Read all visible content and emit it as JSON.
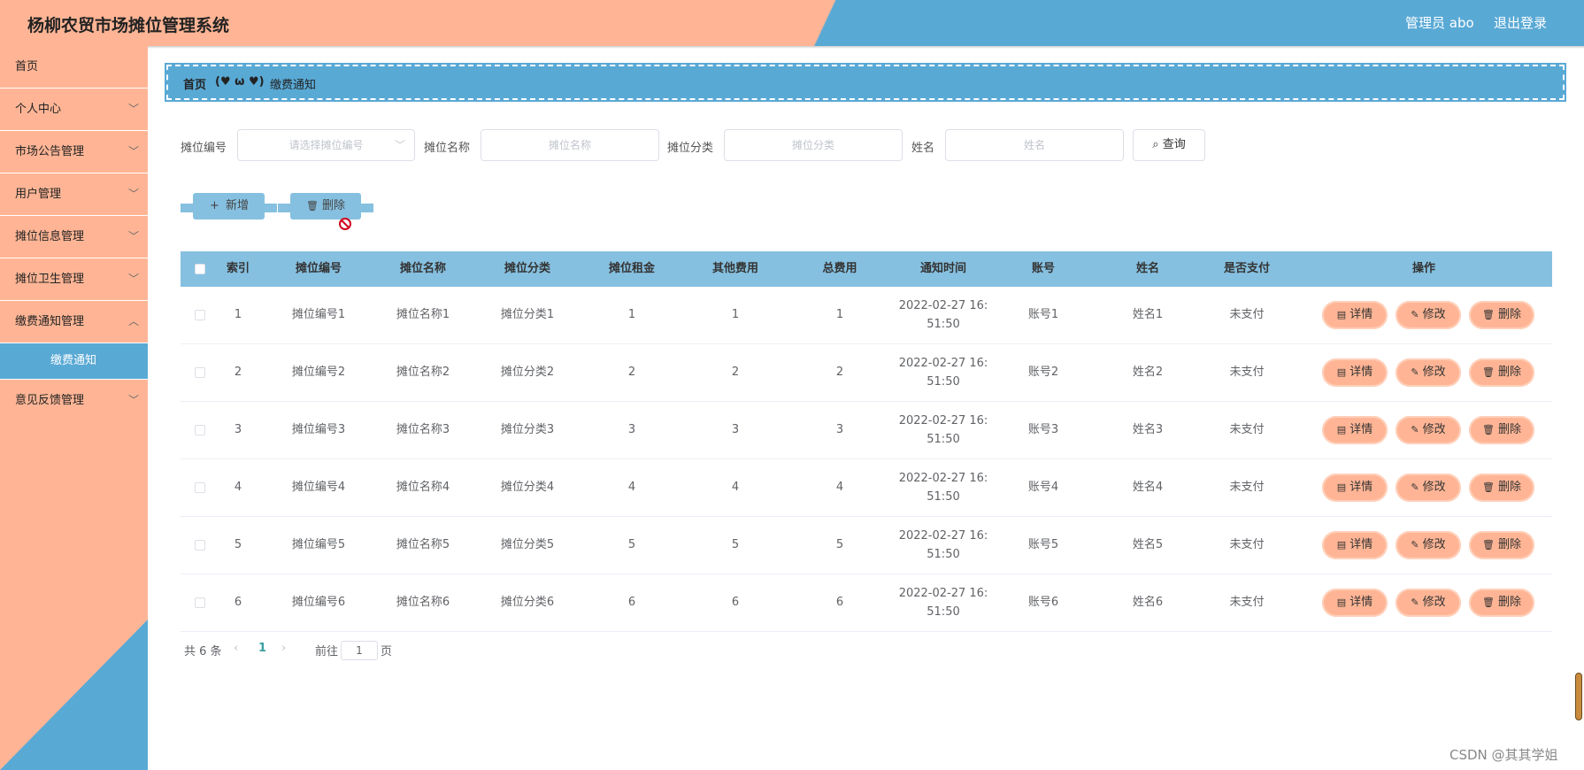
{
  "header": {
    "title": "杨柳农贸市场摊位管理系统",
    "admin": "管理员 abo",
    "logout": "退出登录"
  },
  "sidebar": {
    "items": [
      {
        "label": "首页",
        "has_chevron": false
      },
      {
        "label": "个人中心",
        "has_chevron": true
      },
      {
        "label": "市场公告管理",
        "has_chevron": true
      },
      {
        "label": "用户管理",
        "has_chevron": true
      },
      {
        "label": "摊位信息管理",
        "has_chevron": true
      },
      {
        "label": "摊位卫生管理",
        "has_chevron": true
      },
      {
        "label": "缴费通知管理",
        "has_chevron": true
      }
    ],
    "active_sub": "缴费通知",
    "last_item": "意见反馈管理"
  },
  "breadcrumb": {
    "home": "首页",
    "separator": "(♥ ω ♥)",
    "current": "缴费通知"
  },
  "search": {
    "stall_no_label": "摊位编号",
    "stall_no_placeholder": "请选择摊位编号",
    "stall_name_label": "摊位名称",
    "stall_name_placeholder": "摊位名称",
    "stall_cat_label": "摊位分类",
    "stall_cat_placeholder": "摊位分类",
    "name_label": "姓名",
    "name_placeholder": "姓名",
    "query_button": "查询"
  },
  "actions": {
    "add": "新增",
    "delete": "删除"
  },
  "table": {
    "headers": [
      "索引",
      "摊位编号",
      "摊位名称",
      "摊位分类",
      "摊位租金",
      "其他费用",
      "总费用",
      "通知时间",
      "账号",
      "姓名",
      "是否支付",
      "操作"
    ],
    "rows": [
      {
        "idx": "1",
        "no": "摊位编号1",
        "name": "摊位名称1",
        "cat": "摊位分类1",
        "rent": "1",
        "other": "1",
        "total": "1",
        "time": "2022-02-27 16:51:50",
        "time_a": "2022-02-27 16:",
        "time_b": "51:50",
        "account": "账号1",
        "person": "姓名1",
        "paid": "未支付"
      },
      {
        "idx": "2",
        "no": "摊位编号2",
        "name": "摊位名称2",
        "cat": "摊位分类2",
        "rent": "2",
        "other": "2",
        "total": "2",
        "time": "2022-02-27 16:51:50",
        "time_a": "2022-02-27 16:",
        "time_b": "51:50",
        "account": "账号2",
        "person": "姓名2",
        "paid": "未支付"
      },
      {
        "idx": "3",
        "no": "摊位编号3",
        "name": "摊位名称3",
        "cat": "摊位分类3",
        "rent": "3",
        "other": "3",
        "total": "3",
        "time": "2022-02-27 16:51:50",
        "time_a": "2022-02-27 16:",
        "time_b": "51:50",
        "account": "账号3",
        "person": "姓名3",
        "paid": "未支付"
      },
      {
        "idx": "4",
        "no": "摊位编号4",
        "name": "摊位名称4",
        "cat": "摊位分类4",
        "rent": "4",
        "other": "4",
        "total": "4",
        "time": "2022-02-27 16:51:50",
        "time_a": "2022-02-27 16:",
        "time_b": "51:50",
        "account": "账号4",
        "person": "姓名4",
        "paid": "未支付"
      },
      {
        "idx": "5",
        "no": "摊位编号5",
        "name": "摊位名称5",
        "cat": "摊位分类5",
        "rent": "5",
        "other": "5",
        "total": "5",
        "time": "2022-02-27 16:51:50",
        "time_a": "2022-02-27 16:",
        "time_b": "51:50",
        "account": "账号5",
        "person": "姓名5",
        "paid": "未支付"
      },
      {
        "idx": "6",
        "no": "摊位编号6",
        "name": "摊位名称6",
        "cat": "摊位分类6",
        "rent": "6",
        "other": "6",
        "total": "6",
        "time": "2022-02-27 16:51:50",
        "time_a": "2022-02-27 16:",
        "time_b": "51:50",
        "account": "账号6",
        "person": "姓名6",
        "paid": "未支付"
      }
    ],
    "op_labels": {
      "detail": "详情",
      "edit": "修改",
      "delete": "删除"
    }
  },
  "pagination": {
    "total": "共 6 条",
    "current_page": "1",
    "goto_prefix": "前往",
    "goto_value": "1",
    "goto_suffix": "页"
  },
  "watermark": "CSDN @其其学姐",
  "colors": {
    "peach": "#ffb595",
    "blue": "#59a9d5",
    "table_header": "#86c0e0"
  }
}
